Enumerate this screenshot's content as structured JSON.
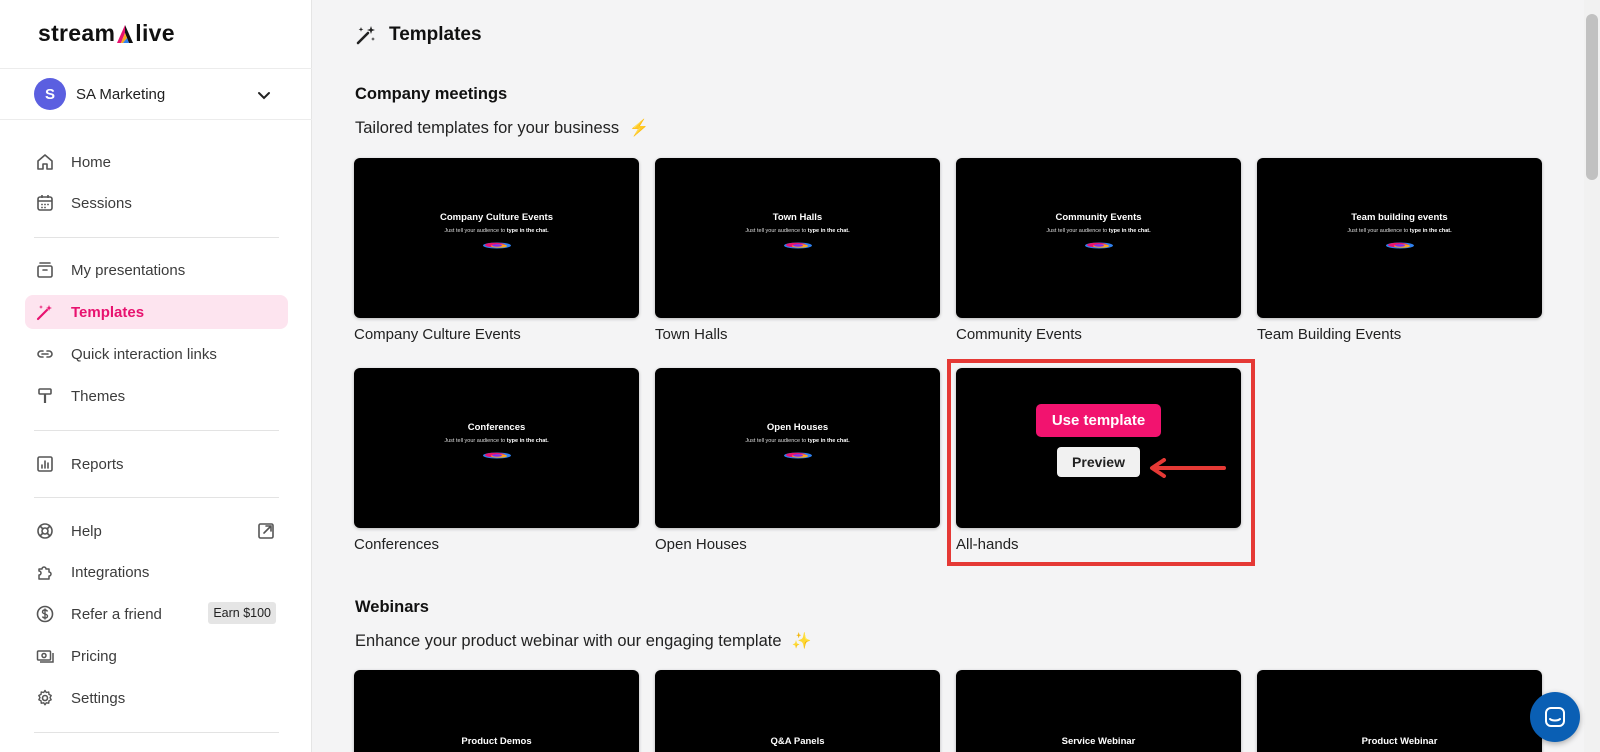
{
  "brand": {
    "logo_text_left": "stream",
    "logo_text_right": "live",
    "accent": "#e8126f"
  },
  "workspace": {
    "avatar_letter": "S",
    "name": "SA Marketing"
  },
  "sidebar": {
    "items": [
      {
        "label": "Home",
        "icon": "home-icon"
      },
      {
        "label": "Sessions",
        "icon": "calendar-icon"
      },
      {
        "label": "My presentations",
        "icon": "presentation-icon"
      },
      {
        "label": "Templates",
        "icon": "magic-wand-icon",
        "active": true
      },
      {
        "label": "Quick interaction links",
        "icon": "link-icon"
      },
      {
        "label": "Themes",
        "icon": "paint-roller-icon"
      },
      {
        "label": "Reports",
        "icon": "chart-icon"
      },
      {
        "label": "Help",
        "icon": "lifebuoy-icon"
      },
      {
        "label": "Integrations",
        "icon": "puzzle-icon"
      },
      {
        "label": "Refer a friend",
        "icon": "dollar-icon",
        "badge": "Earn $100"
      },
      {
        "label": "Pricing",
        "icon": "cash-icon"
      },
      {
        "label": "Settings",
        "icon": "gear-icon"
      }
    ]
  },
  "main": {
    "title": "Templates",
    "sections": [
      {
        "title": "Company meetings",
        "subtitle": "Tailored templates for your business",
        "subtitle_emoji": "⚡",
        "cards": [
          {
            "thumb_title": "Company Culture Events",
            "label": "Company Culture Events"
          },
          {
            "thumb_title": "Town Halls",
            "label": "Town Halls"
          },
          {
            "thumb_title": "Community Events",
            "label": "Community Events"
          },
          {
            "thumb_title": "Team building events",
            "label": "Team Building Events"
          },
          {
            "thumb_title": "Conferences",
            "label": "Conferences"
          },
          {
            "thumb_title": "Open Houses",
            "label": "Open Houses"
          },
          {
            "thumb_title": "",
            "label": "All-hands"
          }
        ]
      },
      {
        "title": "Webinars",
        "subtitle": "Enhance your product webinar with our engaging template",
        "subtitle_emoji": "✨",
        "cards": [
          {
            "thumb_title": "Product Demos"
          },
          {
            "thumb_title": "Q&A Panels"
          },
          {
            "thumb_title": "Service Webinar"
          },
          {
            "thumb_title": "Product Webinar"
          }
        ]
      }
    ],
    "thumb_subtitle_plain": "Just tell your audience to ",
    "thumb_subtitle_bold": "type in the chat.",
    "hover": {
      "use_label": "Use template",
      "preview_label": "Preview"
    }
  }
}
